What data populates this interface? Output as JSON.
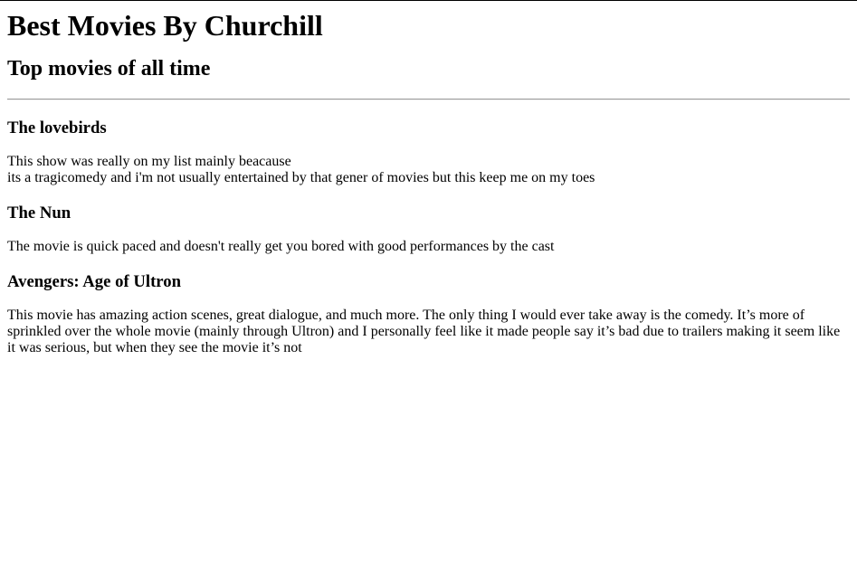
{
  "header": {
    "title": "Best Movies By Churchill",
    "subtitle": "Top movies of all time"
  },
  "movies": [
    {
      "title": "The lovebirds",
      "description_line1": "This show was really on my list mainly beacause",
      "description_line2": "its a tragicomedy and i'm not usually entertained by that gener of movies but this keep me on my toes"
    },
    {
      "title": "The Nun",
      "description": "The movie is quick paced and doesn't really get you bored with good performances by the cast"
    },
    {
      "title": "Avengers: Age of Ultron",
      "description": "This movie has amazing action scenes, great dialogue, and much more. The only thing I would ever take away is the comedy. It’s more of sprinkled over the whole movie (mainly through Ultron) and I personally feel like it made people say it’s bad due to trailers making it seem like it was serious, but when they see the movie it’s not"
    }
  ]
}
